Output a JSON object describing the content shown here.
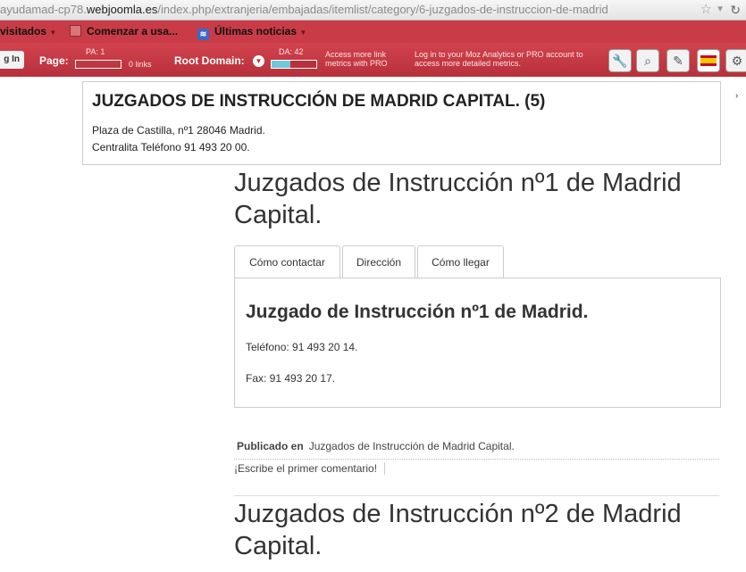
{
  "browser": {
    "url_prefix": "ayudamad-cp78.",
    "url_host": "webjoomla.es",
    "url_path": "/index.php/extranjeria/embajadas/itemlist/category/6-juzgados-de-instruccion-de-madrid",
    "bookmarks": [
      "visitados",
      "Comenzar a usa...",
      "Últimas noticias"
    ]
  },
  "mozbar": {
    "login_label": "g In",
    "page_label": "Page:",
    "pa_caption": "PA: 1",
    "links_text": "0 links",
    "root_domain_label": "Root Domain:",
    "da_caption": "DA: 42",
    "da_value": 42,
    "access_note": "Access more link metrics with PRO",
    "login_note": "Log in to your Moz Analytics or PRO account to access more detailed metrics."
  },
  "category": {
    "title": "JUZGADOS DE INSTRUCCIÓN DE MADRID CAPITAL. (5)",
    "address": "Plaza de Castilla, nº1 28046 Madrid.",
    "phone": "Centralita Teléfono 91 493 20 00."
  },
  "items": [
    {
      "title": "Juzgados de Instrucción nº1 de Madrid Capital.",
      "tabs": [
        "Cómo contactar",
        "Dirección",
        "Cómo llegar"
      ],
      "panel_heading": "Juzgado de Instrucción nº1 de Madrid.",
      "telefono": "Teléfono: 91 493 20 14.",
      "fax": "Fax: 91 493 20 17.",
      "published_label": "Publicado en",
      "published_category": "Juzgados de Instrucción de Madrid Capital.",
      "comment_link": "¡Escribe el primer comentario!"
    },
    {
      "title": "Juzgados de Instrucción nº2 de Madrid Capital."
    }
  ]
}
